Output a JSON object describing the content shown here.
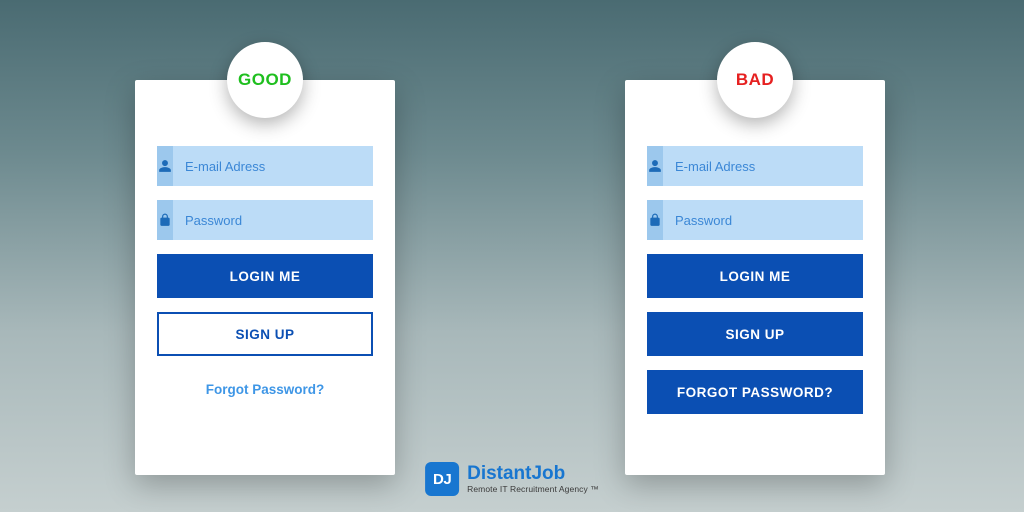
{
  "good": {
    "badge": "GOOD",
    "email_placeholder": "E-mail Adress",
    "password_placeholder": "Password",
    "login_label": "LOGIN ME",
    "signup_label": "SIGN UP",
    "forgot_label": "Forgot Password?"
  },
  "bad": {
    "badge": "BAD",
    "email_placeholder": "E-mail Adress",
    "password_placeholder": "Password",
    "login_label": "LOGIN ME",
    "signup_label": "SIGN UP",
    "forgot_label": "FORGOT PASSWORD?"
  },
  "brand": {
    "logo_text": "DJ",
    "name": "DistantJob",
    "tagline": "Remote IT Recruitment Agency ™"
  },
  "icons": {
    "user": "user-icon",
    "lock": "lock-icon"
  }
}
